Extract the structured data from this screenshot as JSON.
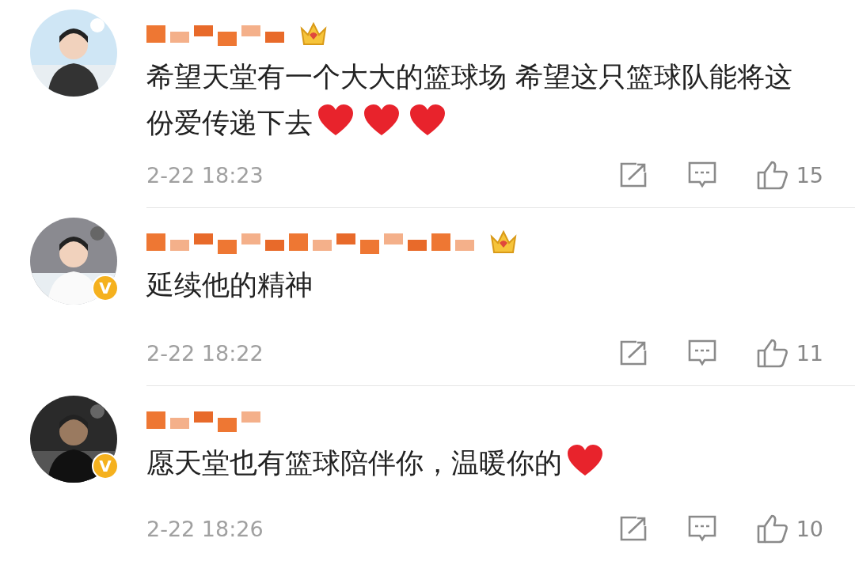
{
  "comments": [
    {
      "avatar": {
        "kind": "picture"
      },
      "verified": false,
      "crown": true,
      "content": [
        {
          "kind": "text",
          "text": "希望天堂有一个大大的篮球场 希望这只篮球队能将这份爱传递下去"
        },
        {
          "kind": "heart"
        },
        {
          "kind": "heart"
        },
        {
          "kind": "heart"
        }
      ],
      "time": "2-22 18:23",
      "likes": "15"
    },
    {
      "avatar": {
        "kind": "picture"
      },
      "verified": true,
      "badge": "V",
      "crown": true,
      "content": [
        {
          "kind": "text",
          "text": "延续他的精神"
        }
      ],
      "time": "2-22 18:22",
      "likes": "11"
    },
    {
      "avatar": {
        "kind": "picture"
      },
      "verified": true,
      "badge": "V",
      "crown": false,
      "content": [
        {
          "kind": "text",
          "text": "愿天堂也有篮球陪伴你，温暖你的"
        },
        {
          "kind": "heart"
        }
      ],
      "time": "2-22 18:26",
      "likes": "10"
    }
  ]
}
